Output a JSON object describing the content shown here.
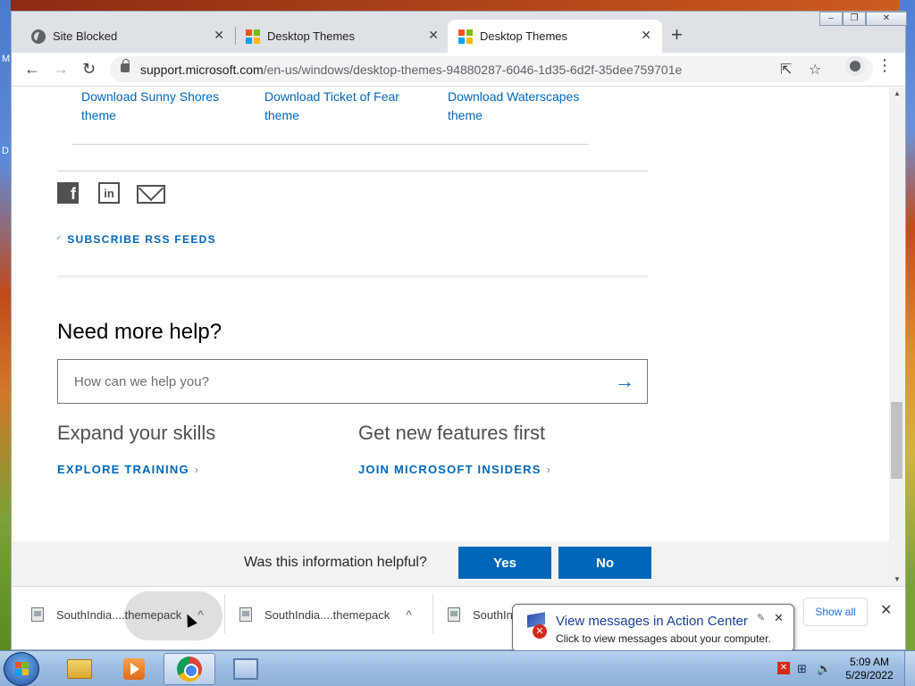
{
  "desktop": {
    "left_letters": [
      "M",
      "D"
    ]
  },
  "tabs": [
    {
      "title": "Site Blocked",
      "icon": "globe-icon",
      "active": false
    },
    {
      "title": "Desktop Themes",
      "icon": "microsoft-logo-icon",
      "active": false
    },
    {
      "title": "Desktop Themes",
      "icon": "microsoft-logo-icon",
      "active": true
    }
  ],
  "tab_close_glyph": "✕",
  "new_tab_glyph": "+",
  "window_controls": {
    "minimize": "‒",
    "restore": "❐",
    "close": "✕"
  },
  "toolbar": {
    "back_glyph": "←",
    "forward_glyph": "→",
    "reload_glyph": "↻",
    "url_host": "support.microsoft.com",
    "url_path": "/en-us/windows/desktop-themes-94880287-6046-1d35-6d2f-35dee759701e",
    "share_glyph": "⇱",
    "bookmark_glyph": "☆",
    "menu_glyph": "⋮"
  },
  "theme_links": [
    "Download Sunny Shores theme",
    "Download Ticket of Fear theme",
    "Download Waterscapes theme"
  ],
  "social": {
    "facebook": "f",
    "linkedin": "in"
  },
  "rss_label": "SUBSCRIBE RSS FEEDS",
  "help": {
    "title": "Need more help?",
    "placeholder": "How can we help you?",
    "submit_glyph": "→"
  },
  "skills": {
    "left_heading": "Expand your skills",
    "left_link": "EXPLORE TRAINING",
    "right_heading": "Get new features first",
    "right_link": "JOIN MICROSOFT INSIDERS",
    "chevron": "›"
  },
  "feedback": {
    "question": "Was this information helpful?",
    "yes": "Yes",
    "no": "No"
  },
  "scrollbar": {
    "up": "▲",
    "down": "▼"
  },
  "downloads": {
    "items": [
      {
        "name": "SouthIndia....themepack"
      },
      {
        "name": "SouthIndia....themepack"
      },
      {
        "name": "SouthIn"
      }
    ],
    "chevron": "^",
    "show_all": "Show all",
    "close_glyph": "✕"
  },
  "balloon": {
    "title": "View messages in Action Center",
    "text": "Click to view messages about your computer.",
    "close_glyph": "✕",
    "pin_glyph": "✎",
    "flag_x": "✕"
  },
  "taskbar": {
    "items": [
      "file-explorer",
      "media-player",
      "chrome",
      "control-panel"
    ],
    "active": "chrome"
  },
  "tray": {
    "network_glyph": "⊞",
    "volume_glyph": "🔊",
    "time": "5:09 AM",
    "date": "5/29/2022"
  },
  "colors": {
    "accent": "#0067b8",
    "link": "#0067b8",
    "tab_strip": "#dee1e6"
  }
}
